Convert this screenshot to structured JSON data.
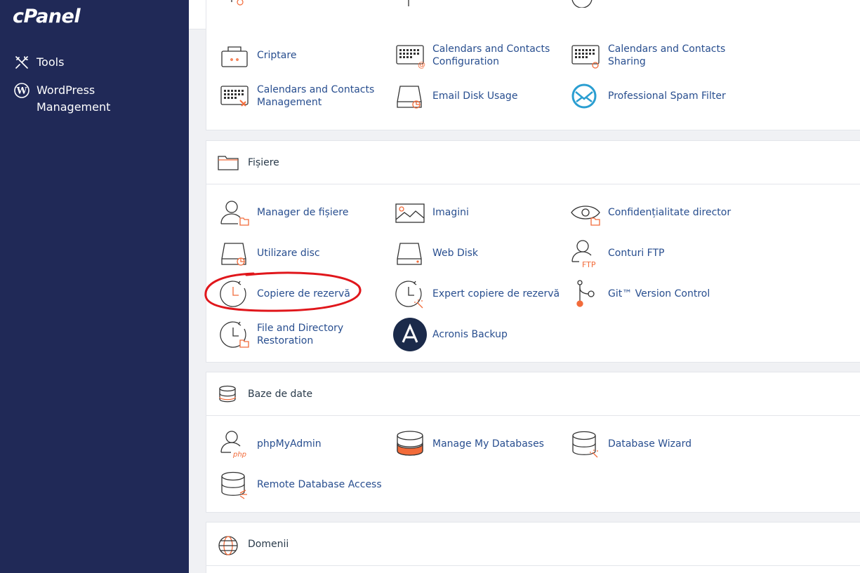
{
  "sidebar": {
    "logo": "cPanel",
    "items": [
      {
        "label": "Tools",
        "icon": "tools-icon"
      },
      {
        "label": "WordPress Management",
        "icon": "wordpress-icon"
      }
    ]
  },
  "email_section": {
    "items": [
      {
        "label": "Criptare",
        "icon": "encryption-icon"
      },
      {
        "label": "Calendars and Contacts Configuration",
        "icon": "calendar-config-icon"
      },
      {
        "label": "Calendars and Contacts Sharing",
        "icon": "calendar-sharing-icon"
      },
      {
        "label": "Calendars and Contacts Management",
        "icon": "calendar-management-icon"
      },
      {
        "label": "Email Disk Usage",
        "icon": "email-disk-usage-icon"
      },
      {
        "label": "Professional Spam Filter",
        "icon": "spam-filter-icon"
      }
    ]
  },
  "files_section": {
    "title": "Fișiere",
    "items": [
      {
        "label": "Manager de fișiere",
        "icon": "file-manager-icon"
      },
      {
        "label": "Imagini",
        "icon": "images-icon"
      },
      {
        "label": "Confidențialitate director",
        "icon": "directory-privacy-icon"
      },
      {
        "label": "Utilizare disc",
        "icon": "disk-usage-icon"
      },
      {
        "label": "Web Disk",
        "icon": "web-disk-icon"
      },
      {
        "label": "Conturi FTP",
        "icon": "ftp-accounts-icon"
      },
      {
        "label": "Copiere de rezervă",
        "icon": "backup-icon"
      },
      {
        "label": "Expert copiere de rezervă",
        "icon": "backup-wizard-icon"
      },
      {
        "label": "Git™ Version Control",
        "icon": "git-icon"
      },
      {
        "label": "File and Directory Restoration",
        "icon": "restoration-icon"
      },
      {
        "label": "Acronis Backup",
        "icon": "acronis-icon"
      }
    ]
  },
  "databases_section": {
    "title": "Baze de date",
    "items": [
      {
        "label": "phpMyAdmin",
        "icon": "phpmyadmin-icon"
      },
      {
        "label": "Manage My Databases",
        "icon": "manage-databases-icon"
      },
      {
        "label": "Database Wizard",
        "icon": "database-wizard-icon"
      },
      {
        "label": "Remote Database Access",
        "icon": "remote-database-icon"
      }
    ]
  },
  "domains_section": {
    "title": "Domenii"
  },
  "colors": {
    "sidebar": "#202957",
    "link": "#284e8f",
    "accent": "#f26b3a",
    "annotation": "#e0161b"
  }
}
